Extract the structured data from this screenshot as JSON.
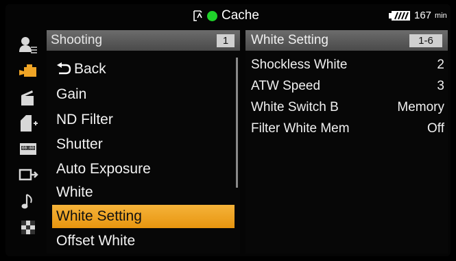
{
  "status_bar": {
    "media_label": "Cache",
    "rec_indicator_color": "#1fd12a",
    "battery_value": "167",
    "battery_unit": "min"
  },
  "side_icons": [
    {
      "name": "user-menu-icon"
    },
    {
      "name": "camera-shooting-icon"
    },
    {
      "name": "clapper-icon"
    },
    {
      "name": "sd-card-icon"
    },
    {
      "name": "timecode-icon"
    },
    {
      "name": "output-icon"
    },
    {
      "name": "audio-note-icon"
    },
    {
      "name": "system-checker-icon"
    }
  ],
  "menu": {
    "title": "Shooting",
    "page": "1",
    "items": [
      "Back",
      "Gain",
      "ND Filter",
      "Shutter",
      "Auto Exposure",
      "White",
      "White Setting",
      "Offset White"
    ],
    "selected_index": 6
  },
  "detail": {
    "title": "White Setting",
    "range": "1-6",
    "rows": [
      {
        "label": "Shockless White",
        "value": "2"
      },
      {
        "label": "ATW Speed",
        "value": "3"
      },
      {
        "label": "White Switch B",
        "value": "Memory"
      },
      {
        "label": "Filter White Mem",
        "value": "Off"
      }
    ]
  },
  "colors": {
    "selection": "#f0a526",
    "header": "#5a5a5a",
    "active_icon": "#f0a526"
  }
}
